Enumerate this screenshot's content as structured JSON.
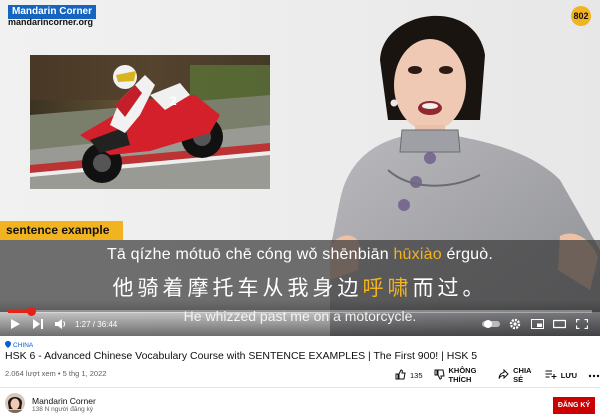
{
  "watermark": {
    "brand": "Mandarin Corner",
    "url": "mandarincorner.org"
  },
  "episode_badge": "802",
  "sentence_label": "sentence example",
  "subtitle": {
    "pinyin_before": "Tā qízhe mótuō chē cóng wǒ shēnbiān ",
    "pinyin_highlight": "hūxiào",
    "pinyin_after": " érguò.",
    "hanzi_before": "他骑着摩托车从我身边",
    "hanzi_highlight": "呼啸",
    "hanzi_after": "而过。",
    "english": "He whizzed past me on a motorcycle."
  },
  "controls": {
    "time": "1:27 / 36:44",
    "progress_fraction": 0.04
  },
  "video": {
    "hashtag": "CHINA",
    "title": "HSK 6 - Advanced Chinese Vocabulary Course with SENTENCE EXAMPLES | The First 900! | HSK 5",
    "views": "2.064 lượt xem",
    "date": "5 thg 1, 2022",
    "meta_separator": "•",
    "likes": "135",
    "dislike_label": "KHÔNG THÍCH",
    "share_label": "CHIA SẺ",
    "save_label": "LƯU"
  },
  "channel": {
    "name": "Mandarin Corner",
    "subscribers": "138 N người đăng ký",
    "subscribe_label": "ĐĂNG KÝ"
  },
  "colors": {
    "accent": "#f2b320",
    "progress": "#e62117",
    "subscribe": "#cc0000",
    "link": "#065fd4"
  }
}
